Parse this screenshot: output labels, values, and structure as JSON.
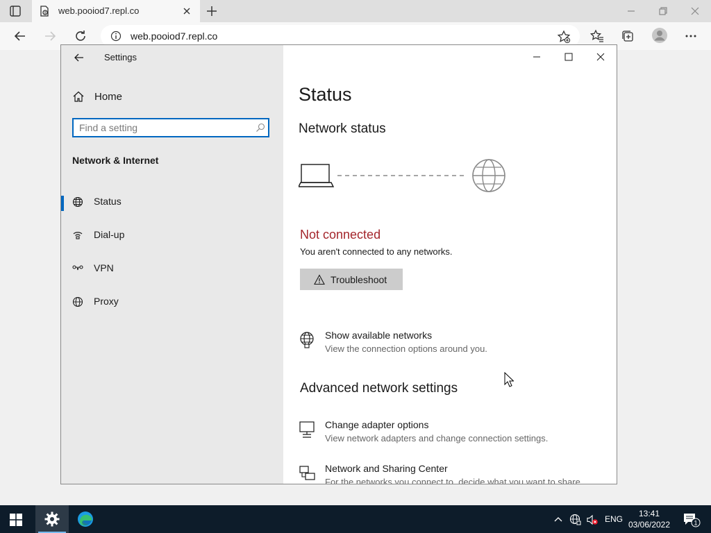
{
  "browser": {
    "tab_title": "web.pooiod7.repl.co",
    "address": "web.pooiod7.repl.co"
  },
  "settings": {
    "window_title": "Settings",
    "home_label": "Home",
    "search_placeholder": "Find a setting",
    "section_title": "Network & Internet",
    "nav_items": [
      {
        "label": "Status",
        "icon": "globe-network-icon",
        "selected": true
      },
      {
        "label": "Dial-up",
        "icon": "phone-icon"
      },
      {
        "label": "VPN",
        "icon": "vpn-icon"
      },
      {
        "label": "Proxy",
        "icon": "globe-icon"
      }
    ],
    "page_title": "Status",
    "network_status_heading": "Network status",
    "status_text": "Not connected",
    "status_description": "You aren't connected to any networks.",
    "troubleshoot_label": "Troubleshoot",
    "show_networks": {
      "title": "Show available networks",
      "description": "View the connection options around you."
    },
    "advanced_heading": "Advanced network settings",
    "advanced_items": [
      {
        "title": "Change adapter options",
        "description": "View network adapters and change connection settings."
      },
      {
        "title": "Network and Sharing Center",
        "description": "For the networks you connect to, decide what you want to share."
      }
    ]
  },
  "taskbar": {
    "language": "ENG",
    "time": "13:41",
    "date": "03/06/2022",
    "notification_count": "1"
  },
  "colors": {
    "accent": "#0067c0",
    "error": "#a4262c",
    "taskbar": "#0d1c2a"
  }
}
